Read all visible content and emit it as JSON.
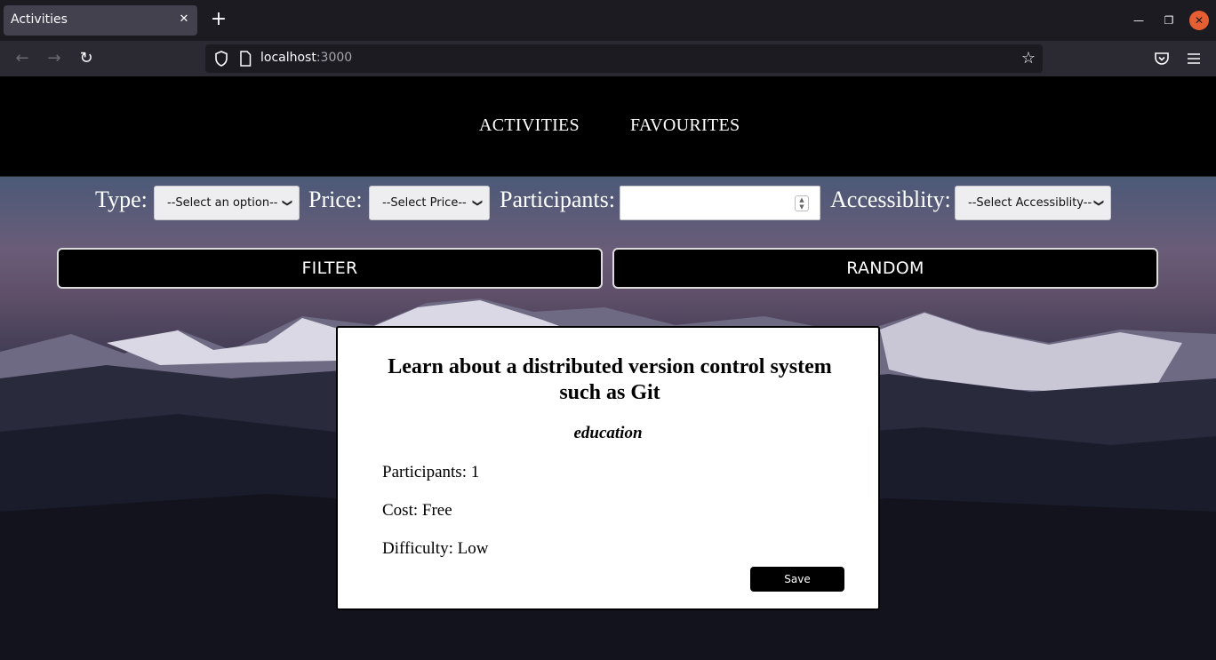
{
  "browser": {
    "tab_title": "Activities",
    "url_host": "localhost",
    "url_port": ":3000"
  },
  "site_nav": {
    "activities": "ACTIVITIES",
    "favourites": "FAVOURITES"
  },
  "filters": {
    "type_label": "Type:",
    "type_selected": "--Select an option--",
    "price_label": "Price:",
    "price_selected": "--Select Price--",
    "participants_label": "Participants:",
    "participants_value": "",
    "accessibility_label": "Accessiblity:",
    "accessibility_selected": "--Select Accessiblity--"
  },
  "actions": {
    "filter": "FILTER",
    "random": "RANDOM"
  },
  "activity": {
    "title": "Learn about a distributed version control system such as Git",
    "type": "education",
    "participants": "Participants: 1",
    "cost": "Cost: Free",
    "difficulty": "Difficulty: Low",
    "save": "Save"
  }
}
